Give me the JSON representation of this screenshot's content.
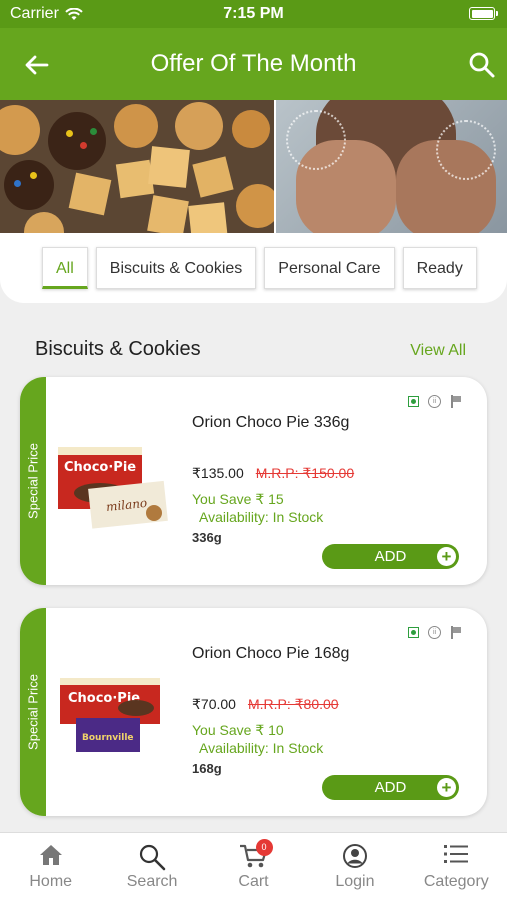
{
  "status": {
    "carrier": "Carrier",
    "time": "7:15 PM"
  },
  "nav": {
    "title": "Offer Of The Month"
  },
  "tabs": [
    "All",
    "Biscuits & Cookies",
    "Personal Care",
    "Ready"
  ],
  "section": {
    "title": "Biscuits & Cookies",
    "view_all": "View All"
  },
  "products": [
    {
      "ribbon": "Special Price",
      "name": "Orion Choco Pie 336g",
      "price": "₹135.00",
      "mrp": "M.R.P: ₹150.00",
      "save": "You Save ₹ 15",
      "availability": "Availability: In Stock",
      "weight": "336g",
      "add_label": "ADD",
      "image_brand": "Choco·Pie",
      "image_sub": "milano"
    },
    {
      "ribbon": "Special Price",
      "name": "Orion Choco Pie 168g",
      "price": "₹70.00",
      "mrp": "M.R.P: ₹80.00",
      "save": "You Save ₹ 10",
      "availability": "Availability: In Stock",
      "weight": "168g",
      "add_label": "ADD",
      "image_brand": "Choco·Pie",
      "image_sub": "Bournville"
    }
  ],
  "bottom_tabs": [
    {
      "label": "Home",
      "icon": "home-icon"
    },
    {
      "label": "Search",
      "icon": "search-icon"
    },
    {
      "label": "Cart",
      "icon": "cart-icon",
      "badge": "0"
    },
    {
      "label": "Login",
      "icon": "user-icon"
    },
    {
      "label": "Category",
      "icon": "list-icon"
    }
  ],
  "colors": {
    "brand_green": "#66a61e",
    "status_green": "#5a9a16",
    "mrp_red": "#e53935"
  }
}
